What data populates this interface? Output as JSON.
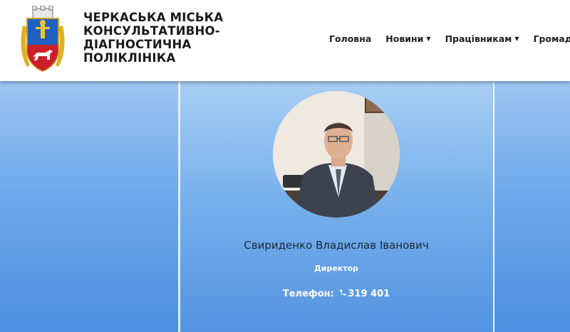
{
  "header": {
    "org_name_lines": [
      "ЧЕРКАСЬКА МІСЬКА",
      "КОНСУЛЬТАТИВНО-",
      "ДІАГНОСТИЧНА",
      "ПОЛІКЛІНІКА"
    ],
    "logo_icon": "city-coat-of-arms-icon"
  },
  "nav": {
    "items": [
      {
        "label": "Головна",
        "has_dropdown": false
      },
      {
        "label": "Новини",
        "has_dropdown": true
      },
      {
        "label": "Працівникам",
        "has_dropdown": true
      },
      {
        "label": "Громада",
        "has_dropdown": false
      }
    ]
  },
  "staff_card": {
    "name": "Свириденко Владислав Іванович",
    "role": "Директор",
    "phone_label": "Телефон:",
    "phone_icon": "phone-icon",
    "phone_number": "319 401"
  },
  "colors": {
    "header_bg": "#ffffff",
    "card_gradient_top": "#a9cff4",
    "card_gradient_bottom": "#5393e1",
    "role_text": "#ffffff"
  }
}
